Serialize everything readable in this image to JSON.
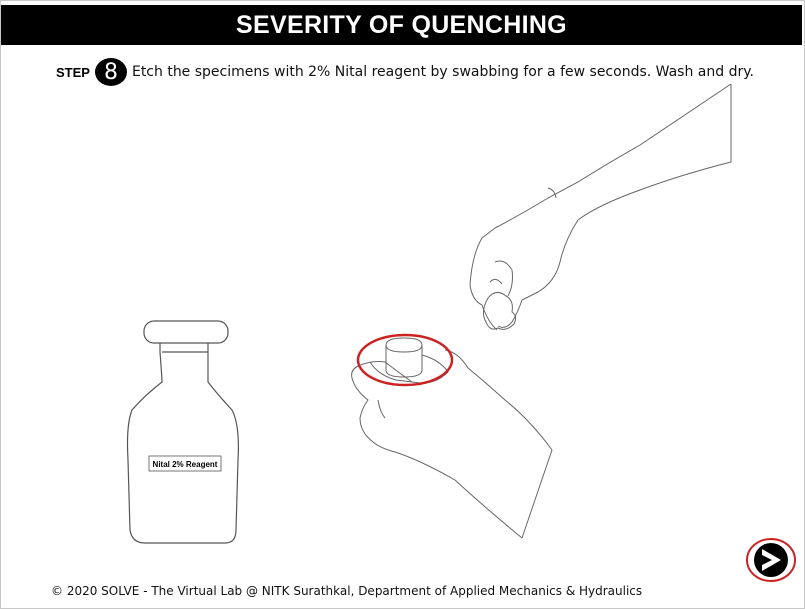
{
  "header": {
    "title": "SEVERITY OF QUENCHING"
  },
  "step": {
    "label": "STEP",
    "number": "8",
    "instruction": "Etch the specimens with 2% Nital reagent by swabbing for a few seconds. Wash and dry."
  },
  "bottle": {
    "label": "Nital 2% Reagent"
  },
  "footer": {
    "copyright": "© 2020 SOLVE - The Virtual Lab @ NITK Surathkal, Department of Applied Mechanics & Hydraulics"
  },
  "colors": {
    "highlight": "#cc2222",
    "title_bg": "#000000"
  },
  "icons": {
    "next": "next-arrow-icon"
  }
}
